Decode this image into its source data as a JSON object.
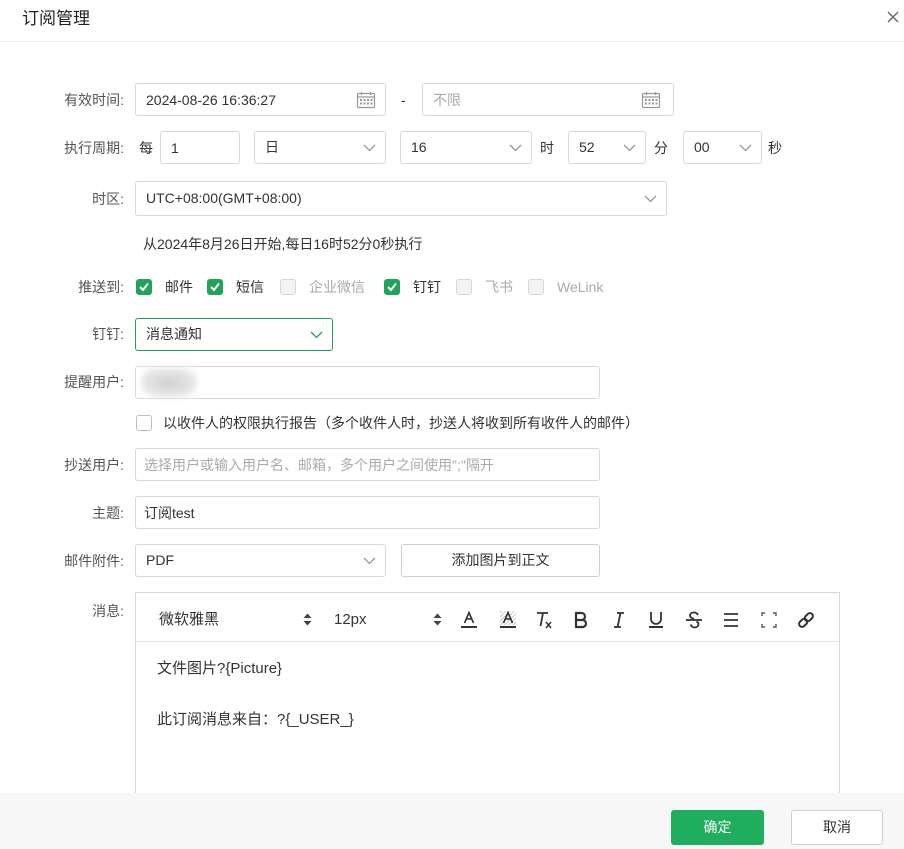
{
  "dialog": {
    "title": "订阅管理",
    "close_icon": "close-icon"
  },
  "form": {
    "valid_time": {
      "label": "有效时间:",
      "start_value": "2024-08-26 16:36:27",
      "separator": "-",
      "end_placeholder": "不限",
      "icon": "calendar-icon"
    },
    "period": {
      "label": "执行周期:",
      "every_text": "每",
      "interval_value": "1",
      "unit_value": "日",
      "hour_value": "16",
      "hour_text": "时",
      "minute_value": "52",
      "minute_text": "分",
      "second_value": "00",
      "second_text": "秒",
      "icon": "chevron-down-icon"
    },
    "timezone": {
      "label": "时区:",
      "value": "UTC+08:00(GMT+08:00)"
    },
    "schedule_summary": "从2024年8月26日开始,每日16时52分0秒执行",
    "push_to": {
      "label": "推送到:",
      "channels": [
        {
          "label": "邮件",
          "checked": true,
          "disabled": false
        },
        {
          "label": "短信",
          "checked": true,
          "disabled": false
        },
        {
          "label": "企业微信",
          "checked": false,
          "disabled": true
        },
        {
          "label": "钉钉",
          "checked": true,
          "disabled": false
        },
        {
          "label": "飞书",
          "checked": false,
          "disabled": true
        },
        {
          "label": "WeLink",
          "checked": false,
          "disabled": true
        }
      ]
    },
    "dingtalk": {
      "label": "钉钉:",
      "value": "消息通知"
    },
    "remind_users": {
      "label": "提醒用户:"
    },
    "recipient_permission": {
      "label": "以收件人的权限执行报告（多个收件人时，抄送人将收到所有收件人的邮件）",
      "checked": false
    },
    "cc_users": {
      "label": "抄送用户:",
      "placeholder": "选择用户或输入用户名、邮箱，多个用户之间使用\";\"隔开"
    },
    "subject": {
      "label": "主题:",
      "value": "订阅test"
    },
    "attachment": {
      "label": "邮件附件:",
      "value": "PDF",
      "add_image_button": "添加图片到正文"
    },
    "message": {
      "label": "消息:",
      "toolbar": {
        "font_select_value": "微软雅黑",
        "size_select_value": "12px",
        "stepper_icon": "sort-arrows-icon",
        "tools": [
          "text-color-icon",
          "highlight-icon",
          "clear-format-icon",
          "bold-icon",
          "italic-icon",
          "underline-icon",
          "strikethrough-icon",
          "align-icon",
          "fullscreen-icon",
          "link-icon"
        ]
      },
      "lines": [
        "文件图片?{Picture}",
        "此订阅消息来自：?{_USER_}"
      ]
    }
  },
  "footer": {
    "confirm_label": "确定",
    "cancel_label": "取消"
  },
  "colors": {
    "accent": "#22a35a",
    "confirm_button": "#1fae5d",
    "border": "#d9d9d9"
  }
}
